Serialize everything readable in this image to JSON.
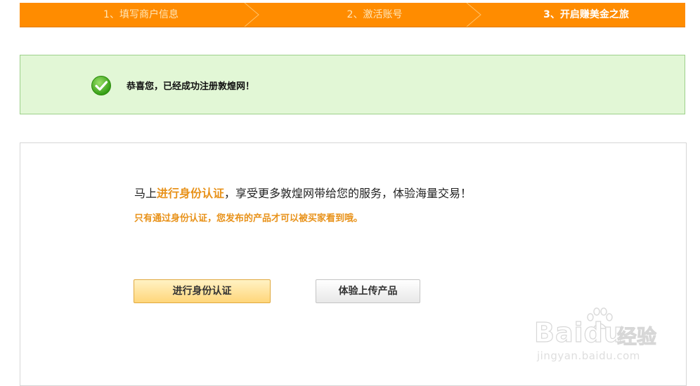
{
  "steps": [
    {
      "label": "1、填写商户信息",
      "active": false
    },
    {
      "label": "2、激活账号",
      "active": false
    },
    {
      "label": "3、开启赚美金之旅",
      "active": true
    }
  ],
  "success": {
    "message": "恭喜您，已经成功注册敦煌网！"
  },
  "promo": {
    "line1_prefix": "马上",
    "line1_highlight": "进行身份认证",
    "line1_suffix": "，享受更多敦煌网带给您的服务，体验海量交易！",
    "line2": "只有通过身份认证，您发布的产品才可以被买家看到哦。"
  },
  "buttons": {
    "verify_label": "进行身份认证",
    "upload_label": "体验上传产品"
  },
  "watermark": {
    "brand": "Baidu",
    "brand_cn": "经验",
    "url": "jingyan.baidu.com"
  },
  "colors": {
    "step_bar": "#ff8c00",
    "success_bg": "#e2f7d6",
    "highlight": "#e8921a"
  }
}
